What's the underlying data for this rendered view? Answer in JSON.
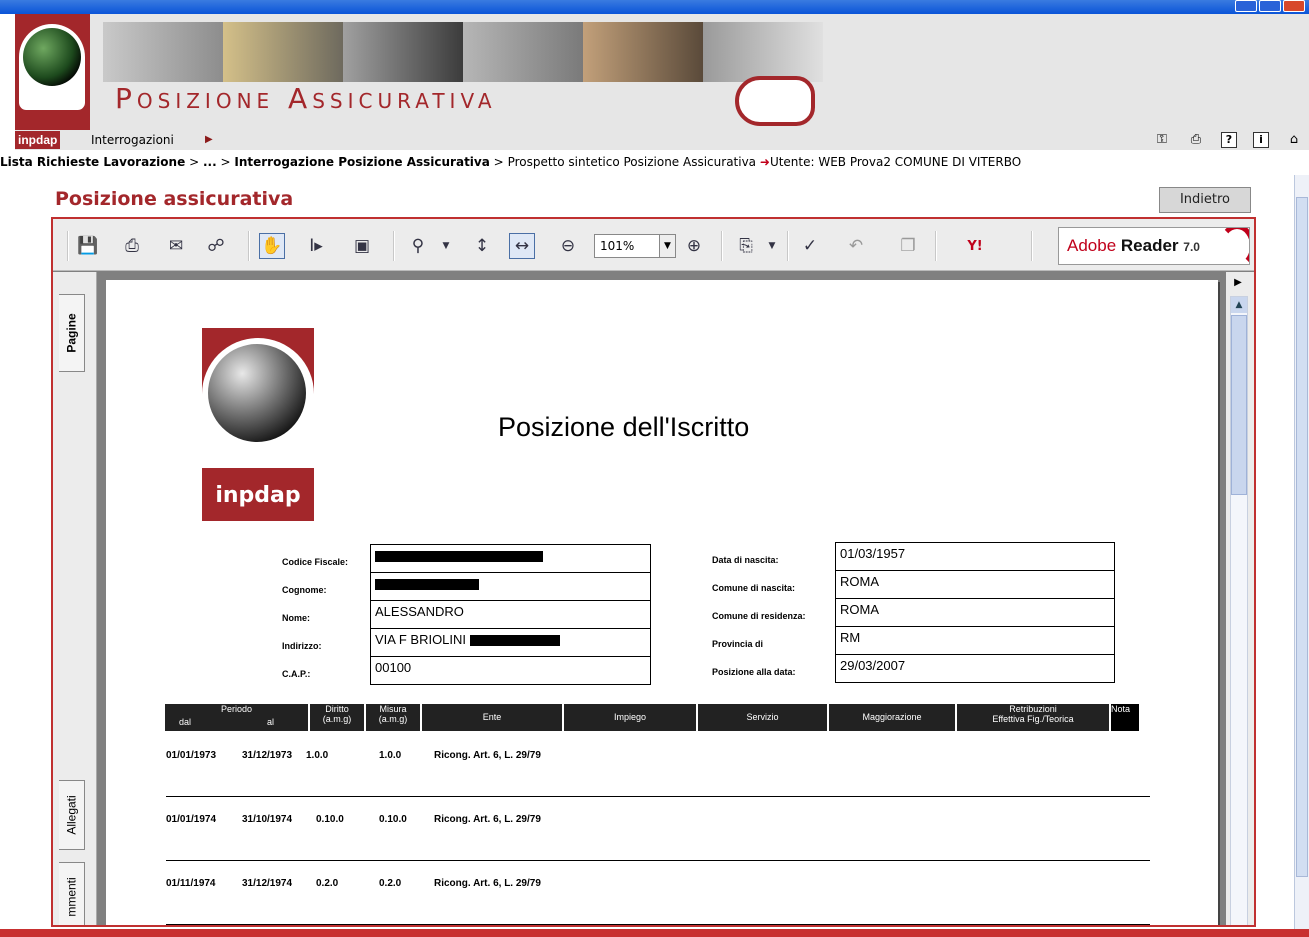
{
  "header": {
    "banner_title": "Posizione Assicurativa",
    "logo_text": "inpdap"
  },
  "menu": {
    "items": [
      {
        "label": "Interrogazioni"
      }
    ]
  },
  "breadcrumb": {
    "part1": "Lista Richieste Lavorazione",
    "part2": "...",
    "part3": "Interrogazione Posizione Assicurativa",
    "part4": "Prospetto sintetico Posizione Assicurativa",
    "user": "Utente: WEB Prova2   COMUNE DI VITERBO",
    "separator": ">"
  },
  "section": {
    "title": "Posizione assicurativa",
    "back_label": "Indietro"
  },
  "viewer": {
    "zoom": "101%",
    "badge_brand": "Adobe",
    "badge_product": "Reader",
    "badge_version": "7.0",
    "side_tabs": {
      "pages": "Pagine",
      "attachments": "Allegati",
      "comments": "mmenti"
    }
  },
  "document": {
    "logo_text": "inpdap",
    "title": "Posizione dell'Iscritto",
    "left_fields": [
      {
        "label": "Codice Fiscale:",
        "value": "",
        "redacted": true
      },
      {
        "label": "Cognome:",
        "value": "",
        "redacted": true
      },
      {
        "label": "Nome:",
        "value": "ALESSANDRO"
      },
      {
        "label": "Indirizzo:",
        "value": "VIA F BRIOLINI"
      },
      {
        "label": "C.A.P.:",
        "value": "00100"
      }
    ],
    "right_fields": [
      {
        "label": "Data di nascita:",
        "value": "01/03/1957"
      },
      {
        "label": "Comune di nascita:",
        "value": "ROMA"
      },
      {
        "label": "Comune di residenza:",
        "value": "ROMA"
      },
      {
        "label": "Provincia di",
        "value": "RM"
      },
      {
        "label": "Posizione alla data:",
        "value": "29/03/2007"
      }
    ],
    "table": {
      "headers": {
        "periodo": "Periodo",
        "dal": "dal",
        "al": "al",
        "diritto": "Diritto",
        "diritto_unit": "(a.m.g)",
        "misura": "Misura",
        "misura_unit": "(a.m.g)",
        "ente": "Ente",
        "impiego": "Impiego",
        "servizio": "Servizio",
        "maggiorazione": "Maggiorazione",
        "retribuzioni": "Retribuzioni",
        "retribuzioni_sub": "Effettiva   Fig./Teorica",
        "nota": "Nota"
      },
      "rows": [
        {
          "dal": "01/01/1973",
          "al": "31/12/1973",
          "diritto": "1.0.0",
          "misura": "1.0.0",
          "ente": "Ricong. Art. 6, L. 29/79"
        },
        {
          "dal": "01/01/1974",
          "al": "31/10/1974",
          "diritto": "0.10.0",
          "misura": "0.10.0",
          "ente": "Ricong. Art. 6, L. 29/79"
        },
        {
          "dal": "01/11/1974",
          "al": "31/12/1974",
          "diritto": "0.2.0",
          "misura": "0.2.0",
          "ente": "Ricong. Art. 6, L. 29/79"
        }
      ]
    }
  },
  "colors": {
    "brand_red": "#a3272b",
    "header_bg": "#e6e6e6",
    "bc_arrow": "#c0001a"
  }
}
